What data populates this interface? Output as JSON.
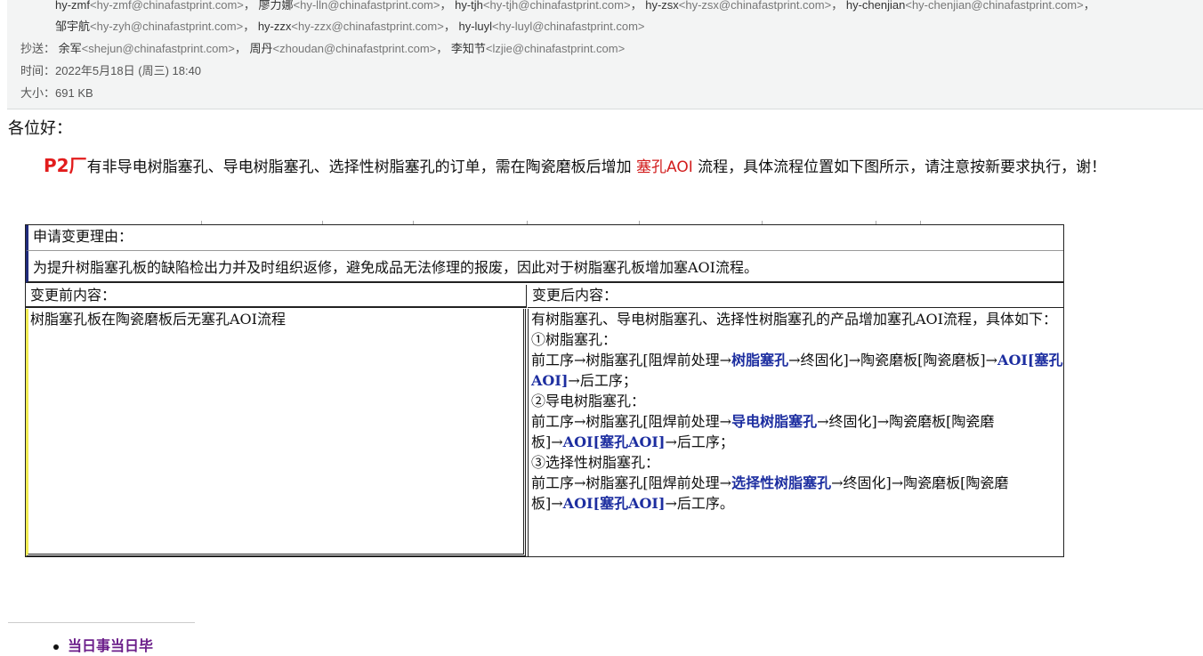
{
  "header": {
    "recipients_line1": [
      {
        "name": "hy-zmf",
        "addr": "<hy-zmf@chinafastprint.com>"
      },
      {
        "name": "廖力娜",
        "addr": "<hy-lln@chinafastprint.com>"
      },
      {
        "name": "hy-tjh",
        "addr": "<hy-tjh@chinafastprint.com>"
      },
      {
        "name": "hy-zsx",
        "addr": "<hy-zsx@chinafastprint.com>"
      },
      {
        "name": "hy-chenjian",
        "addr": "<hy-chenjian@chinafastprint.com>"
      }
    ],
    "recipients_line2": [
      {
        "name": "邹宇航",
        "addr": "<hy-zyh@chinafastprint.com>"
      },
      {
        "name": "hy-zzx",
        "addr": "<hy-zzx@chinafastprint.com>"
      },
      {
        "name": "hy-luyl",
        "addr": "<hy-luyl@chinafastprint.com>"
      }
    ],
    "cc_label": "抄送：",
    "cc": [
      {
        "name": "余军",
        "addr": "<shejun@chinafastprint.com>"
      },
      {
        "name": "周丹",
        "addr": "<zhoudan@chinafastprint.com>"
      },
      {
        "name": "李知节",
        "addr": "<lzjie@chinafastprint.com>"
      }
    ],
    "time_label": "时间：",
    "time_value": "2022年5月18日 (周三) 18:40",
    "size_label": "大小：",
    "size_value": "691 KB",
    "sep": "，"
  },
  "body": {
    "greeting": "各位好：",
    "lead": "P2厂",
    "text1": "有非导电树脂塞孔、导电树脂塞孔、选择性树脂塞孔的订单，需在陶瓷磨板后增加",
    "highlight": "塞孔AOI",
    "text2": "流程，具体流程位置如下图所示，请注意按新要求执行，谢！"
  },
  "change_table": {
    "reason_title": "申请变更理由：",
    "reason_body": "为提升树脂塞孔板的缺陷检出力并及时组织返修，避免成品无法修理的报废，因此对于树脂塞孔板增加塞AOI流程。",
    "before_title": "变更前内容：",
    "before_body": "树脂塞孔板在陶瓷磨板后无塞孔AOI流程",
    "after_title": "变更后内容：",
    "after_intro": "有树脂塞孔、导电树脂塞孔、选择性树脂塞孔的产品增加塞孔AOI流程，具体如下：",
    "items": [
      {
        "title": "①树脂塞孔：",
        "pre": "前工序→树脂塞孔[阻焊前处理→",
        "bold1": "树脂塞孔",
        "mid": "→终固化]→陶瓷磨板[陶瓷磨板]→",
        "bold2": "AOI[塞孔AOI]",
        "post": "→后工序；"
      },
      {
        "title": "②导电树脂塞孔：",
        "pre": "前工序→树脂塞孔[阻焊前处理→",
        "bold1": "导电树脂塞孔",
        "mid": "→终固化]→陶瓷磨板[陶瓷磨板]→",
        "bold2": "AOI[塞孔AOI]",
        "post": "→后工序；"
      },
      {
        "title": "③选择性树脂塞孔：",
        "pre": "前工序→树脂塞孔[阻焊前处理→",
        "bold1": "选择性树脂塞孔",
        "mid": "→终固化]→陶瓷磨板[陶瓷磨板]→",
        "bold2": "AOI[塞孔AOI]",
        "post": "→后工序。"
      }
    ]
  },
  "signature": {
    "text": "当日事当日毕"
  }
}
